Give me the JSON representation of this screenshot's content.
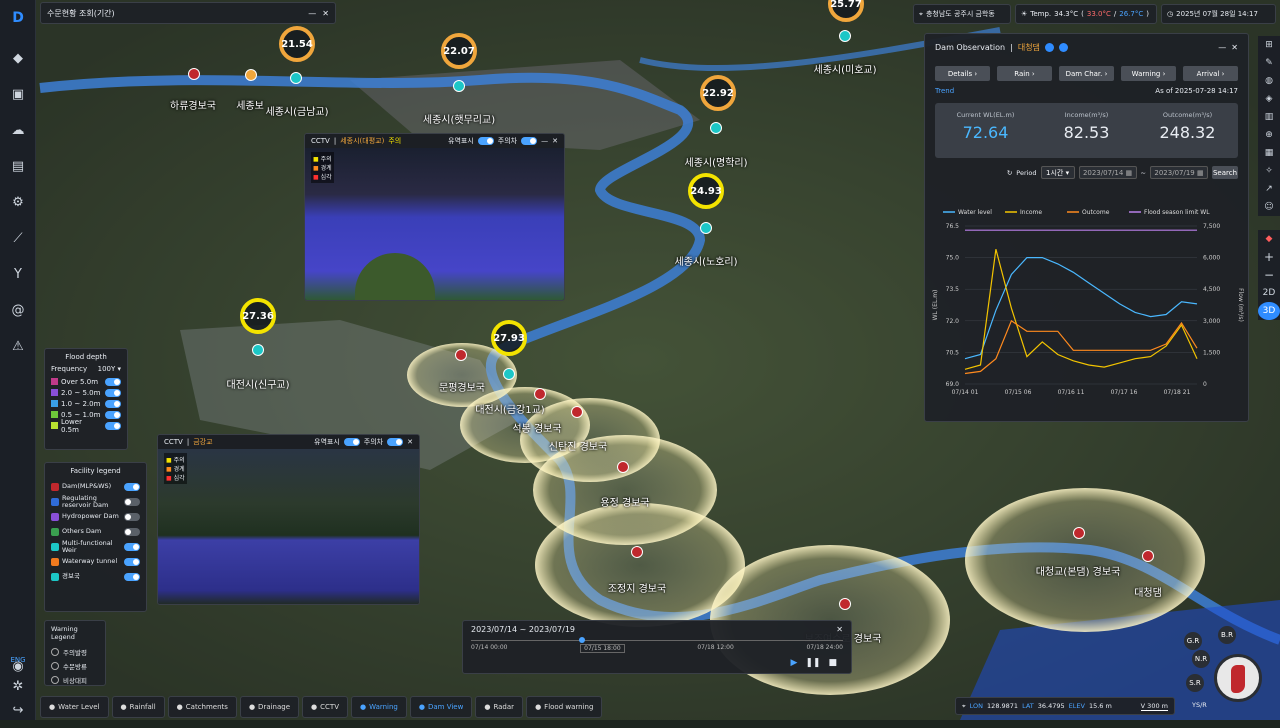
{
  "app": {
    "breadcrumb": "수문현황 조회(기간)",
    "location": "충청남도 공주시 금학동",
    "temp_label": "Temp.",
    "temp_value": "34.3°C",
    "temp_range_high": "33.0°C",
    "temp_range_low": "26.7°C",
    "datetime": "2025년 07월 28일 14:17"
  },
  "map": {
    "gauges": [
      {
        "v": "21.54"
      },
      {
        "v": "22.07"
      },
      {
        "v": "22.92"
      },
      {
        "v": "24.93"
      },
      {
        "v": "27.36"
      },
      {
        "v": "27.93"
      },
      {
        "v": "25.77"
      }
    ],
    "labels": [
      "하류경보국",
      "세종보",
      "세종시(금남교)",
      "세종시(햇무리교)",
      "세종시(명학리)",
      "세종시(노호리)",
      "세종시(미호교)",
      "대전시(신구교)",
      "문평경보국",
      "대전시(금강1교)",
      "석봉 경보국",
      "신탄진 경보국",
      "용정 경보국",
      "조정지 경보국",
      "대청교(본댐) 경보국",
      "대청댐",
      "보조여수로 경보국"
    ]
  },
  "cam1": {
    "title": "CCTV",
    "site": "세종시(대평교)",
    "tag": "주의",
    "opt1": "유역표시",
    "opt2": "주의차",
    "legend": [
      "주의",
      "경계",
      "심각"
    ]
  },
  "cam2": {
    "title": "CCTV",
    "site": "금강교",
    "opt1": "유역표시",
    "opt2": "주의차",
    "legend": [
      "주의",
      "경계",
      "심각"
    ]
  },
  "flood": {
    "title": "Flood depth",
    "freq_label": "Frequency",
    "freq_value": "100Y",
    "rows": [
      "Over 5.0m",
      "2.0 ~ 5.0m",
      "1.0 ~ 2.0m",
      "0.5 ~ 1.0m",
      "Lower 0.5m"
    ]
  },
  "facility": {
    "title": "Facility legend",
    "rows": [
      "Dam(MLP&WS)",
      "Regulating reservoir Dam",
      "Hydropower Dam",
      "Others Dam",
      "Multi-functional Weir",
      "Waterway tunnel",
      "경보국"
    ]
  },
  "warning": {
    "title": "Warning Legend",
    "rows": [
      "주의발령",
      "수문방류",
      "비상대피"
    ]
  },
  "dam": {
    "title": "Dam Observation",
    "name": "대청댐",
    "tabs": [
      "Details",
      "Rain",
      "Dam Char.",
      "Warning",
      "Arrival"
    ],
    "trend": "Trend",
    "asof": "As of 2025-07-28 14:17",
    "m1_label": "Current WL(EL.m)",
    "m1_value": "72.64",
    "m2_label": "Income(m³/s)",
    "m2_value": "82.53",
    "m3_label": "Outcome(m³/s)",
    "m3_value": "248.32",
    "period_label": "Period",
    "period_value": "1시간",
    "date_from": "2023/07/14",
    "date_to": "2023/07/19",
    "search": "Search"
  },
  "chart_data": {
    "type": "line",
    "xlabel": "",
    "ylabel": "WL (EL.m)",
    "y2label": "Flow (m³/s)",
    "x": [
      "07/14 01",
      "07/15 06",
      "07/16 11",
      "07/17 16",
      "07/18 21"
    ],
    "ylim": [
      69,
      76.5
    ],
    "y2lim": [
      0,
      7500
    ],
    "yticks": [
      "76.5",
      "75.0",
      "73.5",
      "72.0",
      "70.5",
      "69.0"
    ],
    "y2ticks": [
      "7,500",
      "6,000",
      "4,500",
      "3,000",
      "1,500",
      "0"
    ],
    "series": [
      {
        "name": "Water level",
        "color": "#4ab8ff",
        "axis": "left",
        "values": [
          70.2,
          70.4,
          72.5,
          74.2,
          75.0,
          75.0,
          74.7,
          74.3,
          73.8,
          73.3,
          72.8,
          72.4,
          72.2,
          72.3,
          72.9,
          72.8
        ]
      },
      {
        "name": "Income",
        "color": "#f3c400",
        "axis": "right",
        "values": [
          700,
          900,
          6400,
          3600,
          1300,
          2000,
          1400,
          1100,
          900,
          800,
          1000,
          1200,
          1300,
          1800,
          2800,
          1200
        ]
      },
      {
        "name": "Outcome",
        "color": "#ff8a1e",
        "axis": "right",
        "values": [
          500,
          600,
          1200,
          3000,
          2500,
          2500,
          2500,
          1600,
          1600,
          1600,
          1600,
          1600,
          1600,
          1900,
          2900,
          1700
        ]
      },
      {
        "name": "Flood season limit WL",
        "color": "#b87fe8",
        "axis": "left",
        "values": [
          76.3,
          76.3,
          76.3,
          76.3,
          76.3,
          76.3,
          76.3,
          76.3,
          76.3,
          76.3,
          76.3,
          76.3,
          76.3,
          76.3,
          76.3,
          76.3
        ]
      }
    ]
  },
  "timeline": {
    "title": "2023/07/14 ~ 2023/07/19",
    "ticks": [
      "07/14 00:00",
      "07/15 18:00",
      "07/18 12:00",
      "07/18 24:00"
    ]
  },
  "status": {
    "lon_label": "LON",
    "lon": "128.9871",
    "lat_label": "LAT",
    "lat": "36.4795",
    "elev_label": "ELEV",
    "elev": "15.6 m",
    "zoom": "V 300 m",
    "view": "YS/R",
    "compass": [
      "G.R",
      "B.R",
      "N.R",
      "S.R"
    ]
  },
  "bottom": [
    "Water Level",
    "Rainfall",
    "Catchments",
    "Drainage",
    "CCTV",
    "Warning",
    "Dam View",
    "Radar",
    "Flood warning"
  ],
  "mode": {
    "d2": "2D",
    "d3": "3D"
  },
  "lang": "ENG"
}
